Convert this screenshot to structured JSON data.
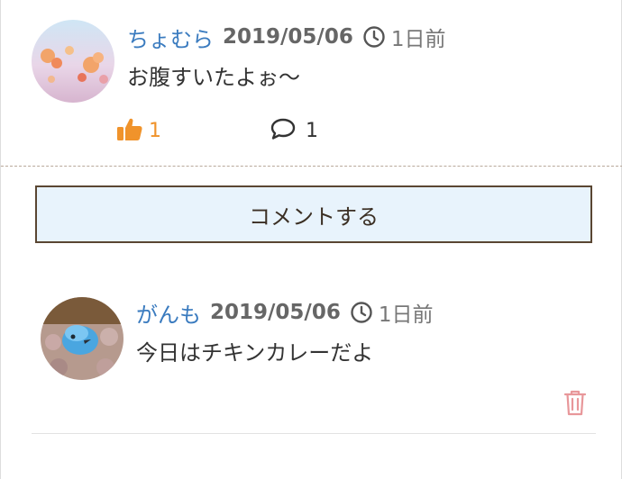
{
  "post": {
    "username": "ちょむら",
    "date": "2019/05/06",
    "time_ago": "1日前",
    "text": "お腹すいたよぉ〜",
    "like_count": "1",
    "comment_count": "1",
    "like_color": "#f0932b"
  },
  "comment_action": {
    "label": "コメントする"
  },
  "reply": {
    "username": "がんも",
    "date": "2019/05/06",
    "time_ago": "1日前",
    "text": "今日はチキンカレーだよ"
  },
  "colors": {
    "username": "#3a7bbf",
    "button_bg": "#e8f3fc",
    "button_border": "#5a4632",
    "trash": "#e8979a"
  },
  "icons": {
    "clock": "clock-icon",
    "like": "thumbs-up-icon",
    "comment": "speech-bubble-icon",
    "trash": "trash-icon"
  }
}
